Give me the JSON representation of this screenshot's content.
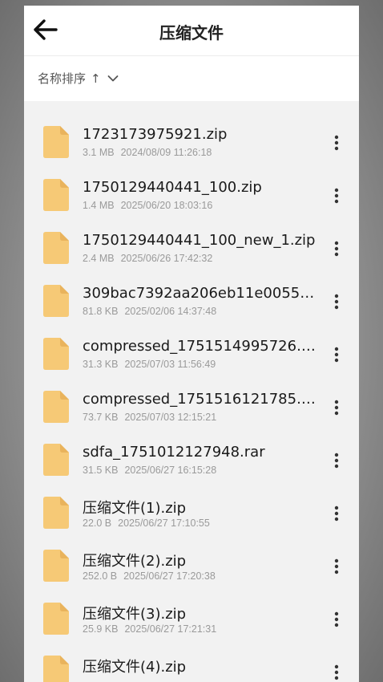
{
  "header": {
    "back_icon": "arrow-left-icon",
    "title": "压缩文件"
  },
  "sortbar": {
    "label": "名称排序",
    "direction_glyph": "↑",
    "dropdown_icon": "chevron-down-icon"
  },
  "colors": {
    "folder_yellow": "#F6C976",
    "folder_fold": "#E9B35C"
  },
  "files": [
    {
      "name": "1723173975921.zip",
      "size": "3.1 MB",
      "date": "2024/08/09 11:26:18"
    },
    {
      "name": "1750129440441_100.zip",
      "size": "1.4 MB",
      "date": "2025/06/20 18:03:16"
    },
    {
      "name": "1750129440441_100_new_1.zip",
      "size": "2.4 MB",
      "date": "2025/06/26 17:42:32"
    },
    {
      "name": "309bac7392aa206eb11e00555d...",
      "size": "81.8 KB",
      "date": "2025/02/06 14:37:48"
    },
    {
      "name": "compressed_1751514995726.zip",
      "size": "31.3 KB",
      "date": "2025/07/03 11:56:49"
    },
    {
      "name": "compressed_1751516121785.zip",
      "size": "73.7 KB",
      "date": "2025/07/03 12:15:21"
    },
    {
      "name": "sdfa_1751012127948.rar",
      "size": "31.5 KB",
      "date": "2025/06/27 16:15:28"
    },
    {
      "name": "压缩文件(1).zip",
      "size": "22.0 B",
      "date": "2025/06/27 17:10:55"
    },
    {
      "name": "压缩文件(2).zip",
      "size": "252.0 B",
      "date": "2025/06/27 17:20:38"
    },
    {
      "name": "压缩文件(3).zip",
      "size": "25.9 KB",
      "date": "2025/06/27 17:21:31"
    },
    {
      "name": "压缩文件(4).zip",
      "size": "",
      "date": ""
    }
  ]
}
